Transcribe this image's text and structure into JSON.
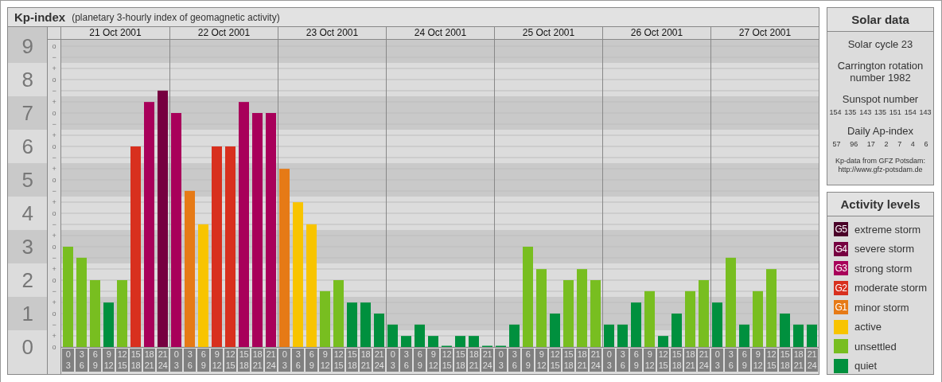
{
  "header": {
    "title": "Kp-index",
    "subtitle": "(planetary 3-hourly index of geomagnetic activity)"
  },
  "chart": {
    "days": [
      {
        "date": "21 Oct 2001",
        "slots": [
          {
            "from": "0",
            "to": "3"
          },
          {
            "from": "3",
            "to": "6"
          },
          {
            "from": "6",
            "to": "9"
          },
          {
            "from": "9",
            "to": "12"
          },
          {
            "from": "12",
            "to": "15"
          },
          {
            "from": "15",
            "to": "18"
          },
          {
            "from": "18",
            "to": "21"
          },
          {
            "from": "21",
            "to": "24"
          }
        ]
      },
      {
        "date": "22 Oct 2001",
        "slots": [
          {
            "from": "0",
            "to": "3"
          },
          {
            "from": "3",
            "to": "6"
          },
          {
            "from": "6",
            "to": "9"
          },
          {
            "from": "9",
            "to": "12"
          },
          {
            "from": "12",
            "to": "15"
          },
          {
            "from": "15",
            "to": "18"
          },
          {
            "from": "18",
            "to": "21"
          },
          {
            "from": "21",
            "to": "24"
          }
        ]
      },
      {
        "date": "23 Oct 2001",
        "slots": [
          {
            "from": "0",
            "to": "3"
          },
          {
            "from": "3",
            "to": "6"
          },
          {
            "from": "6",
            "to": "9"
          },
          {
            "from": "9",
            "to": "12"
          },
          {
            "from": "12",
            "to": "15"
          },
          {
            "from": "15",
            "to": "18"
          },
          {
            "from": "18",
            "to": "21"
          },
          {
            "from": "21",
            "to": "24"
          }
        ]
      },
      {
        "date": "24 Oct 2001",
        "slots": [
          {
            "from": "0",
            "to": "3"
          },
          {
            "from": "3",
            "to": "6"
          },
          {
            "from": "6",
            "to": "9"
          },
          {
            "from": "9",
            "to": "12"
          },
          {
            "from": "12",
            "to": "15"
          },
          {
            "from": "15",
            "to": "18"
          },
          {
            "from": "18",
            "to": "21"
          },
          {
            "from": "21",
            "to": "24"
          }
        ]
      },
      {
        "date": "25 Oct 2001",
        "slots": [
          {
            "from": "0",
            "to": "3"
          },
          {
            "from": "3",
            "to": "6"
          },
          {
            "from": "6",
            "to": "9"
          },
          {
            "from": "9",
            "to": "12"
          },
          {
            "from": "12",
            "to": "15"
          },
          {
            "from": "15",
            "to": "18"
          },
          {
            "from": "18",
            "to": "21"
          },
          {
            "from": "21",
            "to": "24"
          }
        ]
      },
      {
        "date": "26 Oct 2001",
        "slots": [
          {
            "from": "0",
            "to": "3"
          },
          {
            "from": "3",
            "to": "6"
          },
          {
            "from": "6",
            "to": "9"
          },
          {
            "from": "9",
            "to": "12"
          },
          {
            "from": "12",
            "to": "15"
          },
          {
            "from": "15",
            "to": "18"
          },
          {
            "from": "18",
            "to": "21"
          },
          {
            "from": "21",
            "to": "24"
          }
        ]
      },
      {
        "date": "27 Oct 2001",
        "slots": [
          {
            "from": "0",
            "to": "3"
          },
          {
            "from": "3",
            "to": "6"
          },
          {
            "from": "6",
            "to": "9"
          },
          {
            "from": "9",
            "to": "12"
          },
          {
            "from": "12",
            "to": "15"
          },
          {
            "from": "15",
            "to": "18"
          },
          {
            "from": "18",
            "to": "21"
          },
          {
            "from": "21",
            "to": "24"
          }
        ]
      }
    ],
    "minor_ticks": [
      "o",
      "−",
      "+",
      "o",
      "−",
      "+",
      "o",
      "−",
      "+",
      "o",
      "−",
      "+",
      "o",
      "−",
      "+",
      "o",
      "−",
      "+",
      "o",
      "−",
      "+",
      "o",
      "−",
      "+",
      "o",
      "−",
      "+",
      "o"
    ],
    "chart_data": {
      "type": "bar",
      "ylim": [
        0,
        9
      ],
      "grid": true,
      "bands": [
        {
          "axis": "y",
          "from": 0.5,
          "to": 1.5
        },
        {
          "axis": "y",
          "from": 2.5,
          "to": 3.5
        },
        {
          "axis": "y",
          "from": 4.5,
          "to": 5.5
        },
        {
          "axis": "y",
          "from": 6.5,
          "to": 7.5
        },
        {
          "axis": "y",
          "from": 8.5,
          "to": 9.5
        }
      ],
      "yticks": [
        {
          "value": 9,
          "label": "9"
        },
        {
          "value": 8,
          "label": "8"
        },
        {
          "value": 7,
          "label": "7"
        },
        {
          "value": 6,
          "label": "6"
        },
        {
          "value": 5,
          "label": "5"
        },
        {
          "value": 4,
          "label": "4"
        },
        {
          "value": 3,
          "label": "3"
        },
        {
          "value": 2,
          "label": "2"
        },
        {
          "value": 1,
          "label": "1"
        },
        {
          "value": 0,
          "label": "0"
        }
      ],
      "categories": [
        null,
        null,
        null,
        null,
        null,
        null,
        null,
        null,
        null,
        null,
        null,
        null,
        null,
        null,
        null,
        null,
        null,
        null,
        null,
        null,
        null,
        null,
        null,
        null,
        null,
        null,
        null,
        null,
        null,
        null,
        null,
        null,
        null,
        null,
        null,
        null,
        null,
        null,
        null,
        null,
        null,
        null,
        null,
        null,
        null,
        null,
        null,
        null,
        null,
        null,
        null,
        null,
        null,
        null,
        null,
        null
      ],
      "values": [
        3,
        2.67,
        2,
        1.33,
        2,
        6,
        7.33,
        7.67,
        7,
        4.67,
        3.67,
        6,
        6,
        7.33,
        7,
        7,
        5.33,
        4.33,
        3.67,
        1.67,
        2,
        1.33,
        1.33,
        1,
        0.67,
        0.33,
        0.67,
        0.33,
        0,
        0.33,
        0.33,
        0,
        0,
        0.67,
        3,
        2.33,
        1,
        2,
        2.33,
        2,
        0.67,
        0.67,
        1.33,
        1.67,
        0.33,
        1,
        1.67,
        2,
        1.33,
        2.67,
        0.67,
        1.67,
        2.33,
        1,
        0.67,
        0.67
      ]
    }
  },
  "solar_data": {
    "title": "Solar data",
    "cycle": "Solar cycle 23",
    "rotation": "Carrington rotation number 1982",
    "sunspot_label": "Sunspot number",
    "sunspots": [
      "154",
      "135",
      "143",
      "135",
      "151",
      "154",
      "143"
    ],
    "ap_label": "Daily Ap-index",
    "ap": [
      "57",
      "96",
      "17",
      "2",
      "7",
      "4",
      "6"
    ],
    "source": "Kp-data from GFZ Potsdam:",
    "source_url": "http://www.gfz-potsdam.de"
  },
  "activity_levels": {
    "title": "Activity levels",
    "items": [
      {
        "code": "G5",
        "label": "extreme storm",
        "color": "#4a0028"
      },
      {
        "code": "G4",
        "label": "severe storm",
        "color": "#760040"
      },
      {
        "code": "G3",
        "label": "strong storm",
        "color": "#a8005a"
      },
      {
        "code": "G2",
        "label": "moderate storm",
        "color": "#d8301e"
      },
      {
        "code": "G1",
        "label": "minor storm",
        "color": "#e67a16"
      },
      {
        "label": "active",
        "color": "#f8c400"
      },
      {
        "label": "unsettled",
        "color": "#78be20"
      },
      {
        "label": "quiet",
        "color": "#00903e"
      }
    ]
  }
}
